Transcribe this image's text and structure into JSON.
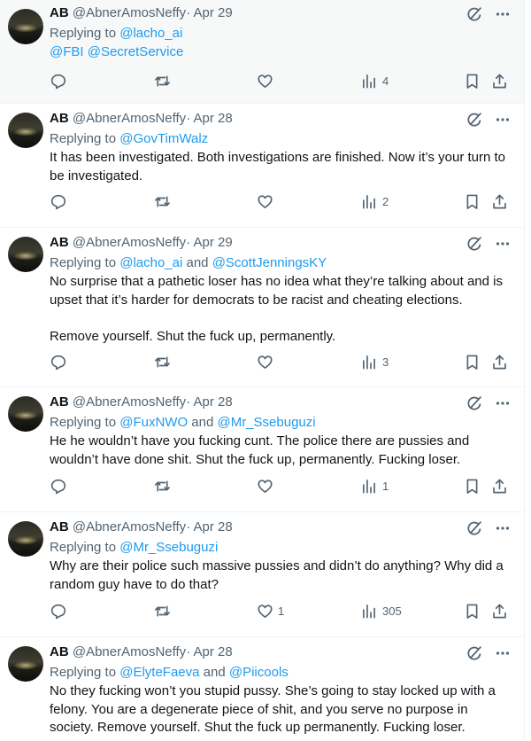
{
  "colors": {
    "link": "#1d9bf0",
    "muted": "#536471",
    "text": "#0f1419",
    "highlight_bg": "#f7f9f9"
  },
  "icons": [
    "grok-icon",
    "more-icon",
    "reply-icon",
    "retweet-icon",
    "like-icon",
    "views-icon",
    "bookmark-icon",
    "share-icon"
  ],
  "tweets": [
    {
      "name": "AB",
      "handle": "@AbnerAmosNeffy",
      "sep": "·",
      "date": "Apr 29",
      "replying_to": "Replying to",
      "reply_parts": [
        "@lacho_ai"
      ],
      "body": [
        "@FBI @SecretService"
      ],
      "likes": "",
      "views": "4"
    },
    {
      "name": "AB",
      "handle": "@AbnerAmosNeffy",
      "sep": "·",
      "date": "Apr 28",
      "replying_to": "Replying to",
      "reply_parts": [
        "@GovTimWalz"
      ],
      "body": [
        "It has been investigated. Both investigations are finished. Now it’s your turn to be investigated."
      ],
      "likes": "",
      "views": "2"
    },
    {
      "name": "AB",
      "handle": "@AbnerAmosNeffy",
      "sep": "·",
      "date": "Apr 29",
      "replying_to": "Replying to",
      "reply_parts": [
        "@lacho_ai",
        "and",
        "@ScottJenningsKY"
      ],
      "body": [
        "No surprise that a pathetic loser has no idea what they’re talking about and is upset that it’s harder for democrats to be racist and cheating elections.",
        "",
        "Remove yourself. Shut the fuck up, permanently."
      ],
      "likes": "",
      "views": "3"
    },
    {
      "name": "AB",
      "handle": "@AbnerAmosNeffy",
      "sep": "·",
      "date": "Apr 28",
      "replying_to": "Replying to",
      "reply_parts": [
        "@FuxNWO",
        "and",
        "@Mr_Ssebuguzi"
      ],
      "body": [
        "He he wouldn’t have you fucking cunt. The police there are pussies and wouldn’t have done shit. Shut the fuck up, permanently. Fucking loser."
      ],
      "likes": "",
      "views": "1"
    },
    {
      "name": "AB",
      "handle": "@AbnerAmosNeffy",
      "sep": "·",
      "date": "Apr 28",
      "replying_to": "Replying to",
      "reply_parts": [
        "@Mr_Ssebuguzi"
      ],
      "body": [
        "Why are their police such massive pussies and didn’t do anything? Why did a random guy have to do that?"
      ],
      "likes": "1",
      "views": "305"
    },
    {
      "name": "AB",
      "handle": "@AbnerAmosNeffy",
      "sep": "·",
      "date": "Apr 28",
      "replying_to": "Replying to",
      "reply_parts": [
        "@ElyteFaeva",
        "and",
        "@Piicools"
      ],
      "body": [
        "No they fucking won’t you stupid pussy. She’s going to stay locked up with a felony. You are a degenerate piece of shit, and you serve no purpose in society. Remove yourself. Shut the fuck up permanently. Fucking loser."
      ],
      "likes": "",
      "views": ""
    }
  ]
}
